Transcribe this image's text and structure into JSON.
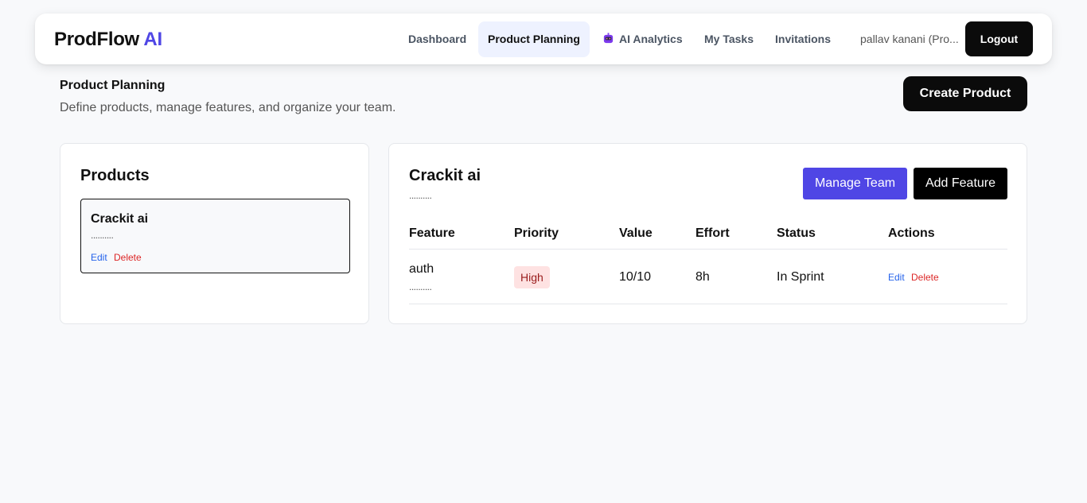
{
  "nav": {
    "brand_main": "ProdFlow",
    "brand_accent": "AI",
    "items": [
      {
        "label": "Dashboard"
      },
      {
        "label": "Product Planning"
      },
      {
        "label": "AI Analytics",
        "icon": "robot-icon"
      },
      {
        "label": "My Tasks"
      },
      {
        "label": "Invitations"
      }
    ],
    "active_item": "Product Planning",
    "user": "pallav kanani (Pro...",
    "logout_label": "Logout"
  },
  "header": {
    "title": "Product Planning",
    "subtitle": "Define products, manage features, and organize your team.",
    "create_label": "Create Product"
  },
  "products": {
    "heading": "Products",
    "items": [
      {
        "name": "Crackit ai",
        "description": "..........",
        "edit_label": "Edit",
        "delete_label": "Delete"
      }
    ]
  },
  "detail": {
    "title": "Crackit ai",
    "description": "..........",
    "manage_label": "Manage Team",
    "add_label": "Add Feature",
    "columns": [
      "Feature",
      "Priority",
      "Value",
      "Effort",
      "Status",
      "Actions"
    ],
    "rows": [
      {
        "feature": "auth",
        "feature_desc": "..........",
        "priority": "High",
        "value": "10/10",
        "effort": "8h",
        "status": "In Sprint",
        "edit_label": "Edit",
        "delete_label": "Delete"
      }
    ]
  },
  "colors": {
    "accent": "#4f46e5",
    "dark_button": "#0b0b0b",
    "priority_high_bg": "#fee2e2",
    "priority_high_text": "#991b1b",
    "link_blue": "#2563eb",
    "link_red": "#dc2626"
  }
}
